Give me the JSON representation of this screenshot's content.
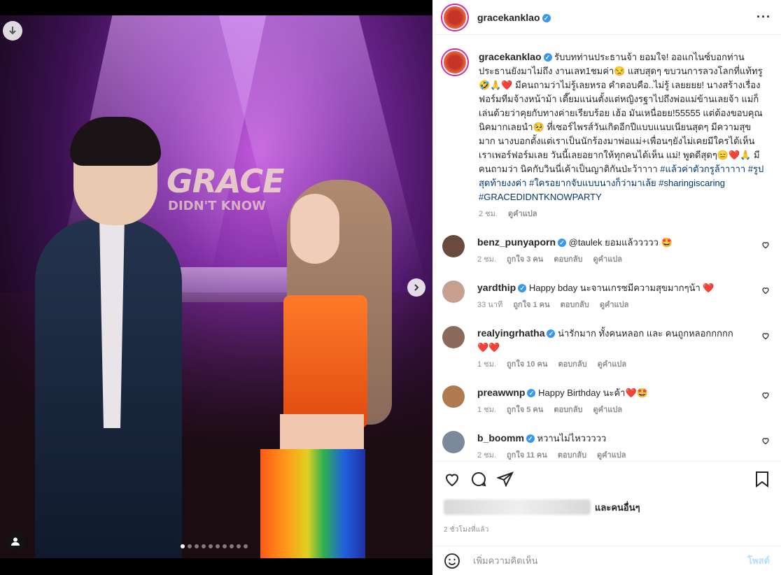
{
  "media": {
    "sign_title": "GRACE",
    "sign_sub": "DIDN'T KNOW",
    "carousel_total": 10,
    "carousel_active": 1
  },
  "post": {
    "username": "gracekanklao",
    "more_label": "···"
  },
  "caption": {
    "username": "gracekanklao",
    "text": "รับบทท่านประธานจ้า ยอมใจ! ออแกไนซ์บอกท่านประธานยังมาไม่ถึง งานเลท1ชมค่า😒 แสบสุดๆ ขบวนการลวงโลกที่แท้ทรู 🤣🙏❤️ มีคนถามว่าไม่รู้เลยหรอ คำตอบคือ..ไม่รู้ เลยยยย! นางสร้างเรื่องฟอร์มทีมจ้างหน้าม้า เตี๊ยมแน่นตั้งแต่หญิงรฐาไปถึงพ่อแม่ข้านเลยจ้า แม่ก็เล่นด้วยว่าคุยกับทางค่ายเรียบร้อย เฮ้อ มันเหนื่อยย!55555 แต่ต้องขอบคุณนิคมากเลยนำ🥺 ที่เซอร์ไพรส์วันเกิดอีกปีแบบแนบเนียนสุดๆ มีความสุขมาก นางบอกตั้งแต่เราเป็นนักร้องมาพ่อแม่+เพื่อนๆยังไม่เคยมีใครได้เห็นเราเพอร์ฟอร์มเลย วันนี้เลยอยากให้ทุกคนได้เห็น แม่! พูดดีสุดๆ😑❤️🙏 มีคนถามว่า นิคกับวินนี่เค้าเป็นญาติกันป่ะว้าาาา",
    "tags": "#แล้วค่าตัวกรูล้าาาาา #รูปสุดท้ายงงค่า #ใครอยากจับแบบนางก็ว่ามาเล้ย #sharingiscaring #GRACEDIDNTKNOWPARTY",
    "time": "2 ชม.",
    "translate": "ดูคำแปล"
  },
  "comments": [
    {
      "username": "benz_punyaporn",
      "text": "@taulek ยอมแล้ววววว 🤩",
      "time": "2 ชม.",
      "likes": "ถูกใจ 3 คน",
      "reply": "ตอบกลับ",
      "translate": "ดูคำแปล",
      "color": "#6a4a3a"
    },
    {
      "username": "yardthip",
      "text": "Happy bday นะจานเกรซมีความสุขมากๆน้า ❤️",
      "time": "33 นาที",
      "likes": "ถูกใจ 1 คน",
      "reply": "ตอบกลับ",
      "translate": "ดูคำแปล",
      "color": "#c8a090"
    },
    {
      "username": "realyingrhatha",
      "text": "น่ารักมาก ทั้งคนหลอก และ คนถูกหลอกกกกก ❤️❤️",
      "time": "1 ชม.",
      "likes": "ถูกใจ 10 คน",
      "reply": "ตอบกลับ",
      "translate": "ดูคำแปล",
      "color": "#8a6a5a"
    },
    {
      "username": "preawwnp",
      "text": "Happy Birthday นะค้า❤️🤩",
      "time": "1 ชม.",
      "likes": "ถูกใจ 5 คน",
      "reply": "ตอบกลับ",
      "translate": "ดูคำแปล",
      "color": "#b07a50"
    },
    {
      "username": "b_boomm",
      "text": "หวานไม่ไหววววว",
      "time": "2 ชม.",
      "likes": "ถูกใจ 11 คน",
      "reply": "ตอบกลับ",
      "translate": "ดูคำแปล",
      "color": "#7a8a9a"
    }
  ],
  "likes_suffix": "และคนอื่นๆ",
  "posted": "2 ชั่วโมงที่แล้ว",
  "add_comment": {
    "placeholder": "เพิ่มความคิดเห็น",
    "post": "โพสต์"
  }
}
